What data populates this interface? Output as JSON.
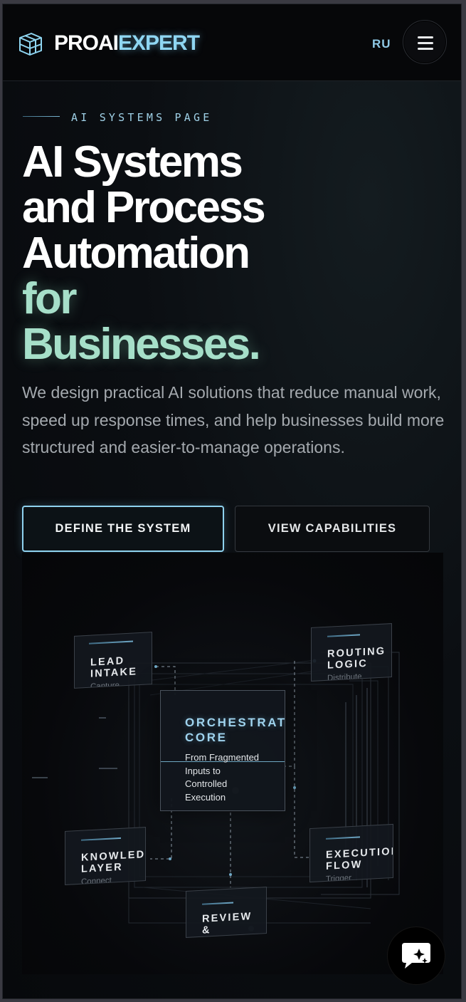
{
  "header": {
    "logo_part1": "PROAI",
    "logo_part2": "EXPERT",
    "lang": "RU"
  },
  "hero": {
    "eyebrow": "AI SYSTEMS PAGE",
    "title_line1": "AI Systems",
    "title_line2": "and Process",
    "title_line3": "Automation",
    "title_accent1": "for",
    "title_accent2": "Businesses.",
    "lead": "We design practical AI solutions that reduce manual work, speed up response times, and help businesses build more structured and easier-to-manage operations.",
    "primary_button": "DEFINE THE SYSTEM",
    "secondary_button": "VIEW CAPABILITIES"
  },
  "diagram": {
    "core_title": "ORCHESTRAT\nCORE",
    "core_sub": "From Fragmented Inputs to Controlled Execution",
    "nodes": [
      {
        "title": "LEAD\nINTAKE",
        "sub": "Capture"
      },
      {
        "title": "ROUTING\nLOGIC",
        "sub": "Distribute"
      },
      {
        "title": "KNOWLEDG\nLAYER",
        "sub": "Connect"
      },
      {
        "title": "EXECUTION\nFLOW",
        "sub": "Trigger"
      },
      {
        "title": "REVIEW\n&",
        "sub": ""
      }
    ]
  },
  "colors": {
    "accent_blue": "#8fd6f2",
    "accent_green": "#a6dfc9",
    "background": "#07090c"
  },
  "icons": {
    "logo": "wireframe-cube-icon",
    "menu": "hamburger-icon",
    "chat": "chat-sparkle-icon"
  }
}
